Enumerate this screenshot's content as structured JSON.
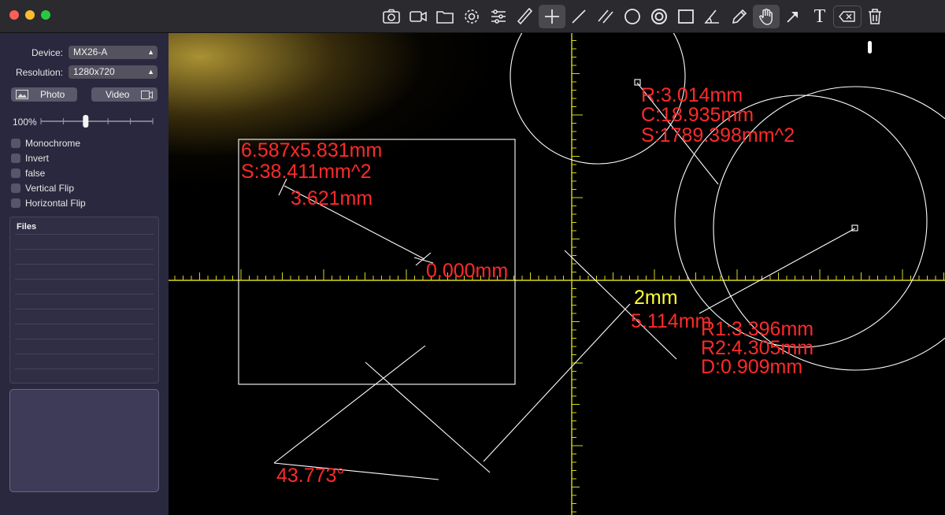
{
  "window": {
    "traffic_colors": [
      "#fe5f57",
      "#febc2e",
      "#28c840"
    ]
  },
  "toolbar": {
    "tools": [
      "camera-icon",
      "video-camera-icon",
      "folder-icon",
      "gear-icon",
      "sliders-icon",
      "ruler-icon",
      "crosshair-icon",
      "line-icon",
      "parallel-lines-icon",
      "circle-icon",
      "concentric-circles-icon",
      "rectangle-icon",
      "angle-icon",
      "pencil-icon",
      "hand-icon",
      "arrow-icon",
      "text-icon",
      "eraser-icon",
      "trash-icon"
    ],
    "text_tool_label": "T"
  },
  "sidebar": {
    "device_label": "Device:",
    "device_value": "MX26-A",
    "resolution_label": "Resolution:",
    "resolution_value": "1280x720",
    "photo_label": "Photo",
    "video_label": "Video",
    "zoom_label": "100%",
    "zoom_level": 0.4,
    "checkboxes": [
      "Monochrome",
      "Invert",
      "false",
      "Vertical Flip",
      "Horizontal Flip"
    ],
    "files_title": "Files"
  },
  "measurements": {
    "rect_size": "6.587x5.831mm",
    "rect_area": "S:38.411mm^2",
    "line_length": "3.621mm",
    "point_distance": "0.000mm",
    "circle_radius": "R:3.014mm",
    "circle_circumference": "C:18.935mm",
    "circle_area": "S:1789.398mm^2",
    "scale_label": "2mm",
    "segment_length": "5.114mm",
    "ring_r1": "R1:3.396mm",
    "ring_r2": "R2:4.305mm",
    "ring_d": "D:0.909mm",
    "angle": "43.773°"
  },
  "colors": {
    "measure_text": "#ff2a2a",
    "scale_text": "#ffff33",
    "ruler": "#d8d820",
    "drawing": "#ffffff",
    "sidebar_bg": "#2a283e"
  }
}
